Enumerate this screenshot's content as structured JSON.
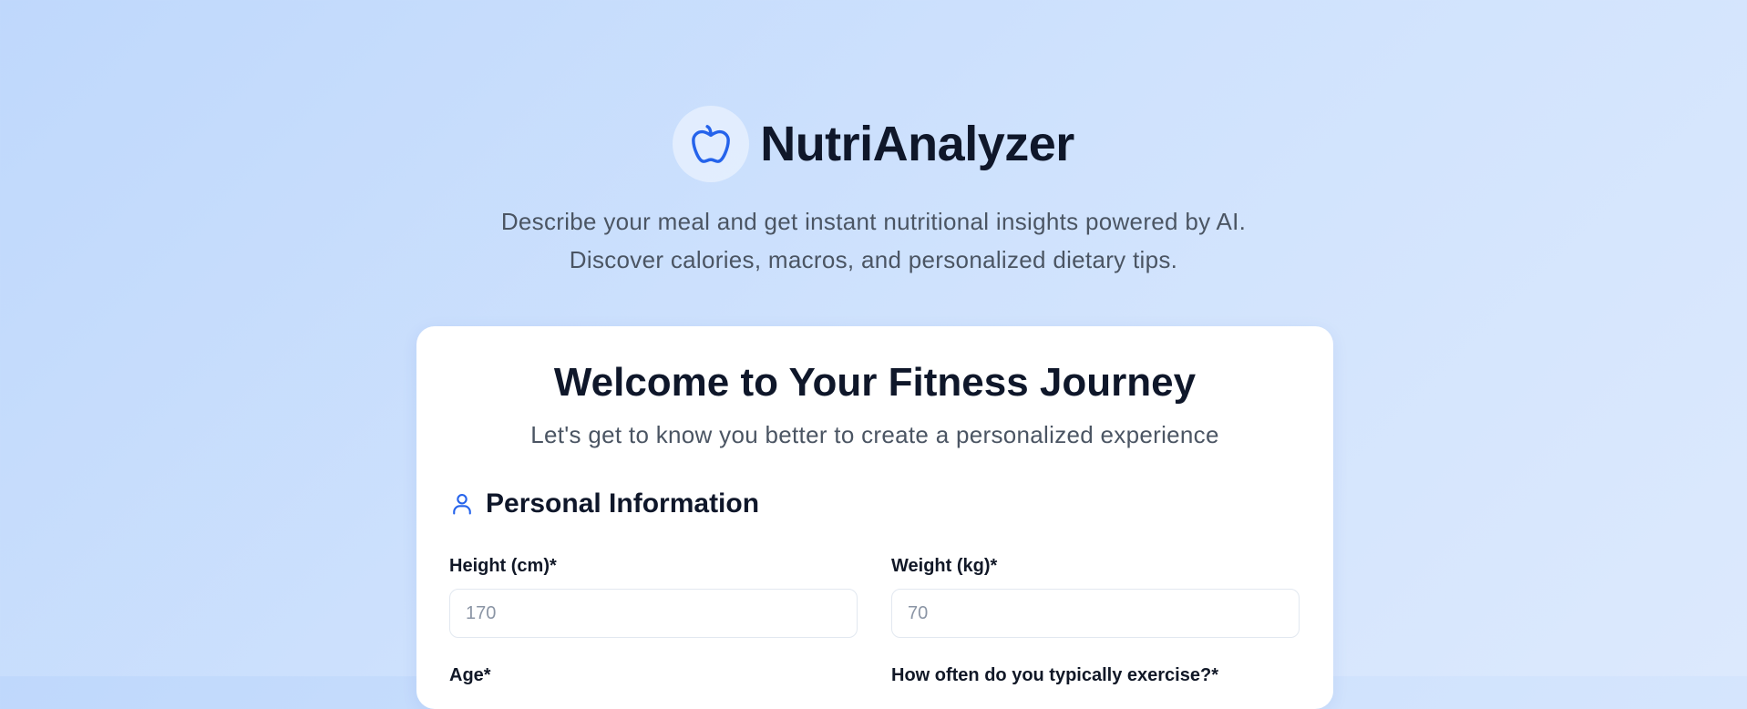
{
  "header": {
    "app_title": "NutriAnalyzer",
    "logo_icon": "apple-icon",
    "tagline_line1": "Describe your meal and get instant nutritional insights powered by AI.",
    "tagline_line2": "Discover calories, macros, and personalized dietary tips."
  },
  "card": {
    "title": "Welcome to Your Fitness Journey",
    "subtitle": "Let's get to know you better to create a personalized experience",
    "section": {
      "icon": "user-icon",
      "title": "Personal Information"
    },
    "fields": {
      "height": {
        "label": "Height (cm)*",
        "placeholder": "170",
        "value": ""
      },
      "weight": {
        "label": "Weight (kg)*",
        "placeholder": "70",
        "value": ""
      },
      "age": {
        "label": "Age*"
      },
      "exercise": {
        "label": "How often do you typically exercise?*"
      }
    }
  },
  "colors": {
    "accent": "#2563eb",
    "title_text": "#0f172a",
    "muted_text": "#4b5563",
    "card_bg": "#ffffff",
    "input_border": "#e2e8f0"
  }
}
